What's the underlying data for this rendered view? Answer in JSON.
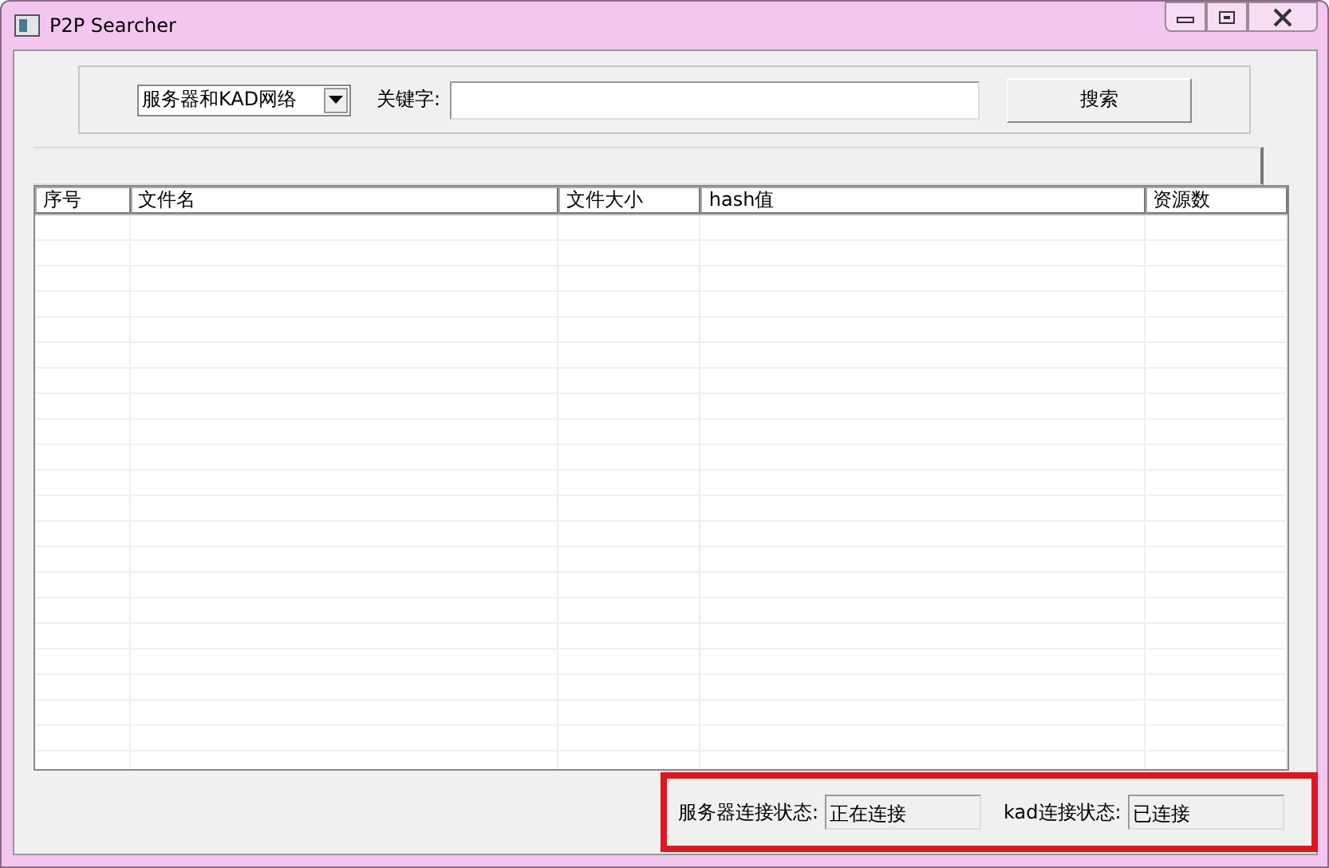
{
  "window": {
    "title": "P2P Searcher"
  },
  "search": {
    "scope": "服务器和KAD网络",
    "keyword_label": "关键字:",
    "button": "搜索"
  },
  "table": {
    "columns": [
      "序号",
      "文件名",
      "文件大小",
      "hash值",
      "资源数"
    ]
  },
  "status": [
    {
      "label": "服务器连接状态:",
      "value": "正在连接"
    },
    {
      "label": "kad连接状态:",
      "value": "已连接"
    }
  ],
  "highlight": {
    "on": true
  }
}
